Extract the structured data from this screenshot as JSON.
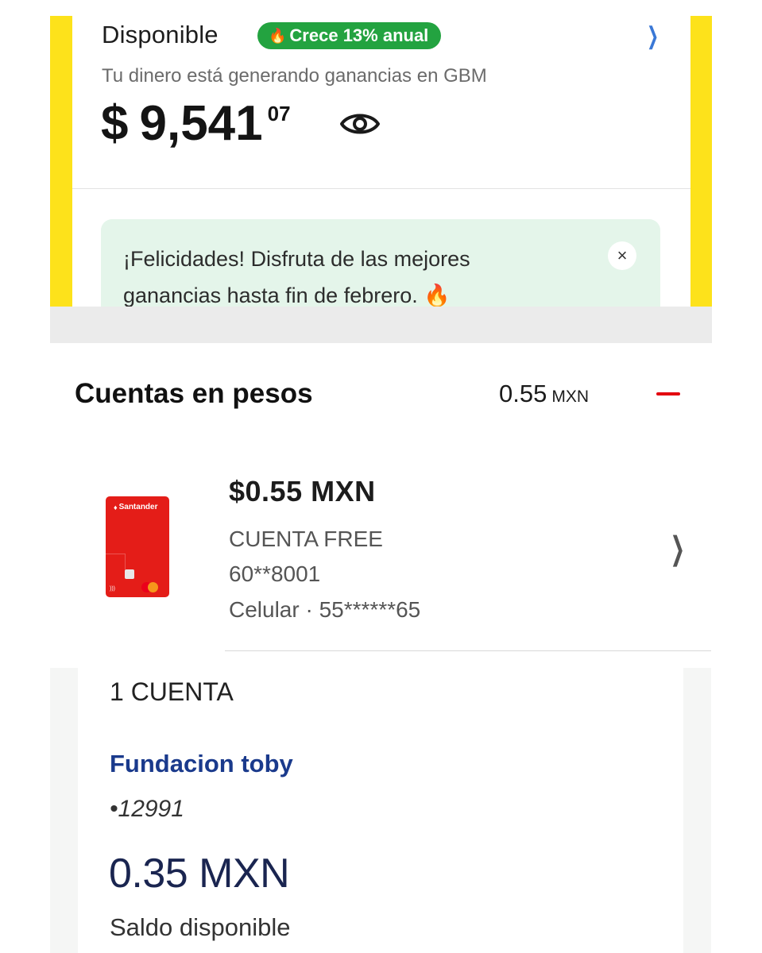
{
  "gbm": {
    "title": "Disponible",
    "badge": {
      "icon": "fire-icon",
      "fire": "🔥",
      "label": "Crece 13% anual"
    },
    "subtitle": "Tu dinero está generando ganancias en GBM",
    "amount": {
      "symbol": "$",
      "integer": "9,541",
      "decimal": "07"
    },
    "banner": {
      "text": "¡Felicidades! Disfruta de las mejores ganancias hasta fin de febrero. 🔥",
      "close": "×"
    },
    "colors": {
      "yellow": "#fde21b",
      "badge_green": "#23a340",
      "banner_bg": "#e4f5ea"
    }
  },
  "santander": {
    "heading": "Cuentas en pesos",
    "total_value": "0.55",
    "total_currency": "MXN",
    "card": {
      "brand": "Santander",
      "color": "#e41d18"
    },
    "balance": "$0.55 MXN",
    "account_type": "CUENTA FREE",
    "account_number": "60**8001",
    "phone": "Celular · 55******65"
  },
  "account": {
    "count": "1 CUENTA",
    "name": "Fundacion toby",
    "number": "•12991",
    "balance": "0.35 MXN",
    "balance_label": "Saldo disponible",
    "name_color": "#1a3a8c"
  }
}
